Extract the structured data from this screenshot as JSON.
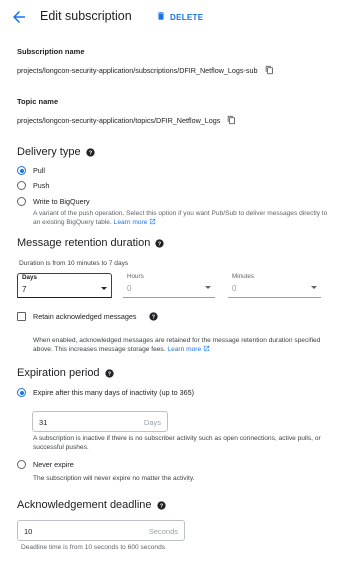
{
  "header": {
    "title": "Edit subscription",
    "delete_label": "DELETE"
  },
  "subscription": {
    "label": "Subscription name",
    "value": "projects/longcon-security-application/subscriptions/DFIR_Netflow_Logs-sub"
  },
  "topic": {
    "label": "Topic name",
    "value": "projects/longcon-security-application/topics/DFIR_Netflow_Logs"
  },
  "delivery": {
    "title": "Delivery type",
    "options": [
      {
        "label": "Pull",
        "checked": true
      },
      {
        "label": "Push",
        "checked": false
      },
      {
        "label": "Write to BigQuery",
        "checked": false
      }
    ],
    "bigquery_desc": "A variant of the push operation. Select this option if you want Pub/Sub to deliver messages directly to an existing BigQuery table.",
    "learn_more": "Learn more"
  },
  "retention": {
    "title": "Message retention duration",
    "hint": "Duration is from 10 minutes to 7 days",
    "days_label": "Days",
    "days_value": "7",
    "hours_label": "Hours",
    "hours_value": "0",
    "minutes_label": "Minutes",
    "minutes_value": "0",
    "retain_label": "Retain acknowledged messages",
    "retain_desc": "When enabled, acknowledged messages are retained for the message retention duration specified above. This increases message storage fees.",
    "learn_more": "Learn more"
  },
  "expiration": {
    "title": "Expiration period",
    "expire_label": "Expire after this many days of inactivity (up to 365)",
    "days_value": "31",
    "days_suffix": "Days",
    "expire_desc": "A subscription is inactive if there is no subscriber activity such as open connections, active pulls, or successful pushes.",
    "never_label": "Never expire",
    "never_desc": "The subscription will never expire no matter the activity."
  },
  "ack": {
    "title": "Acknowledgement deadline",
    "value": "10",
    "suffix": "Seconds",
    "hint": "Deadline time is from 10 seconds to 600 seconds"
  },
  "colors": {
    "accent": "#1a73e8",
    "text": "#202124",
    "muted": "#5f6368"
  }
}
